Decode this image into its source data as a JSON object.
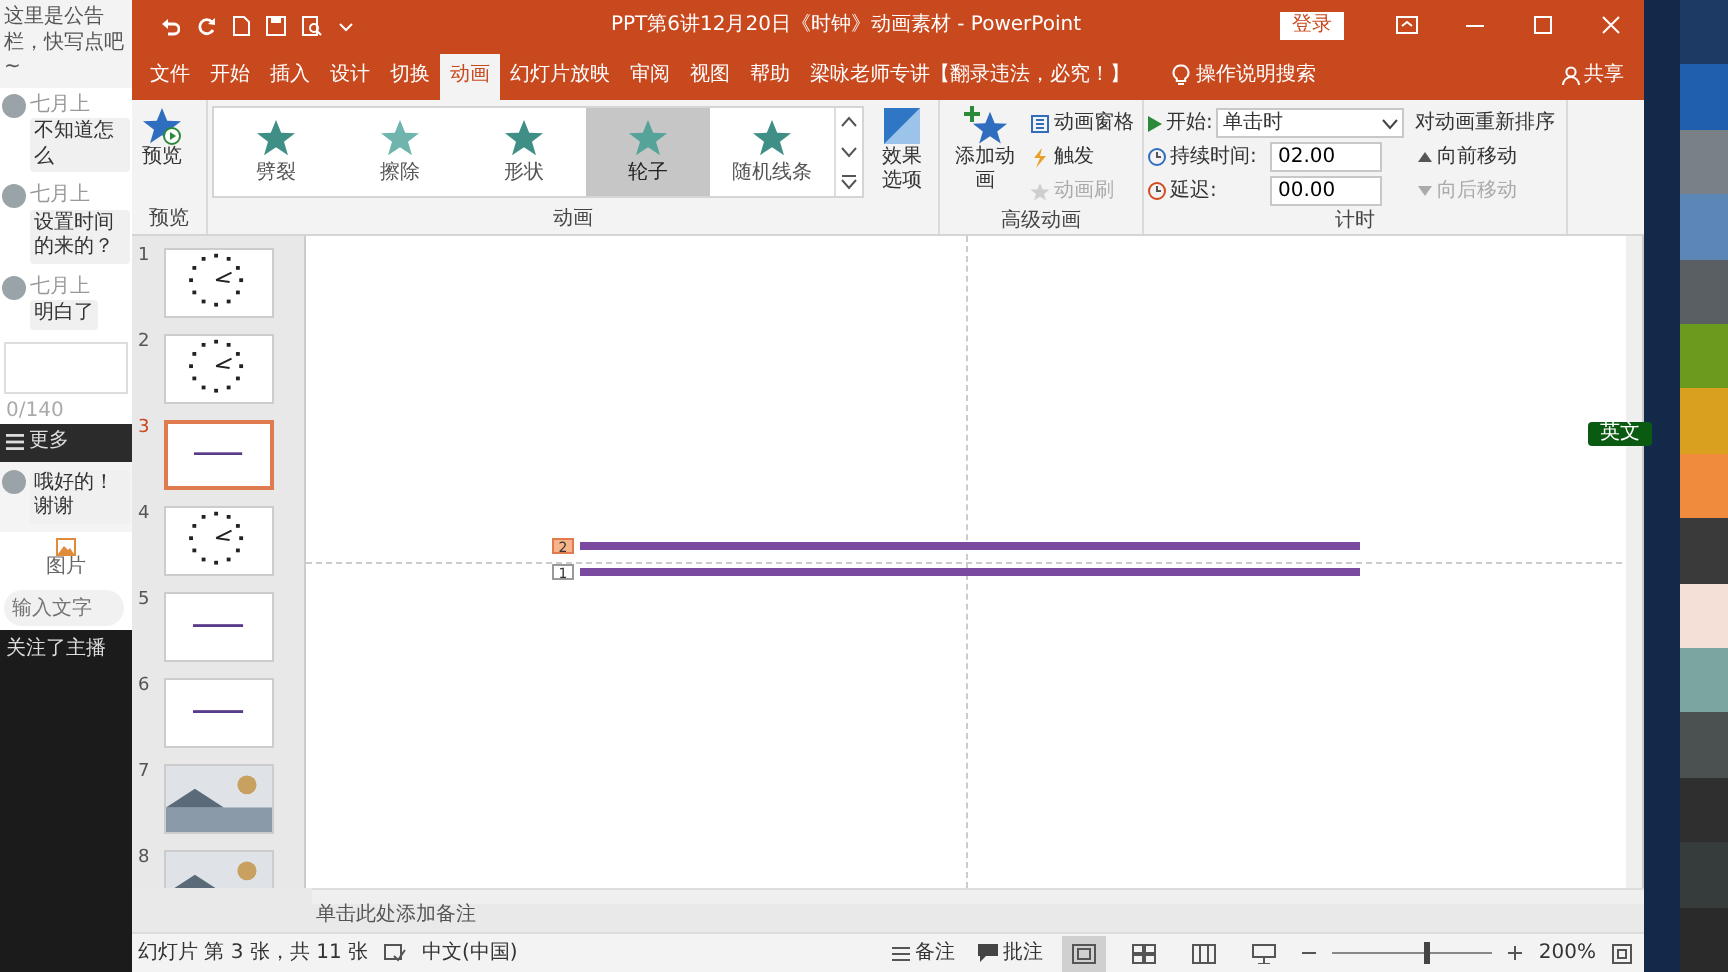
{
  "chat_panel": {
    "notice": "这里是公告栏，快写点吧~",
    "messages": [
      {
        "name": "七月上",
        "text": "不知道怎么"
      },
      {
        "name": "七月上",
        "text": "设置时间的来的？"
      },
      {
        "name": "七月上",
        "text": "明白了"
      }
    ],
    "counter": "0/140",
    "toolbar": [
      "更多"
    ],
    "reply": "哦好的！谢谢",
    "attachment": "图片",
    "input": {
      "placeholder": "输入文字"
    },
    "feed": [
      "关注了主播"
    ]
  },
  "window": {
    "title": "PPT第6讲12月20日《时钟》动画素材  -  PowerPoint",
    "login": "登录"
  },
  "tabs": [
    {
      "label": "文件",
      "selected": false
    },
    {
      "label": "开始",
      "selected": false
    },
    {
      "label": "插入",
      "selected": false
    },
    {
      "label": "设计",
      "selected": false
    },
    {
      "label": "切换",
      "selected": false
    },
    {
      "label": "动画",
      "selected": true
    },
    {
      "label": "幻灯片放映",
      "selected": false
    },
    {
      "label": "审阅",
      "selected": false
    },
    {
      "label": "视图",
      "selected": false
    },
    {
      "label": "帮助",
      "selected": false
    },
    {
      "label": "梁咏老师专讲【翻录违法，必究！】",
      "selected": false
    }
  ],
  "tell_me": "操作说明搜索",
  "share": "共享",
  "ribbon": {
    "preview": {
      "button": "预览",
      "group": "预览"
    },
    "animations": {
      "group": "动画",
      "effects": [
        {
          "label": "劈裂",
          "selected": false
        },
        {
          "label": "擦除",
          "selected": false
        },
        {
          "label": "形状",
          "selected": false
        },
        {
          "label": "轮子",
          "selected": true
        },
        {
          "label": "随机线条",
          "selected": false
        }
      ],
      "effect_options": "效果选项"
    },
    "advanced": {
      "group": "高级动画",
      "add": "添加动画",
      "items": [
        {
          "label": "动画窗格",
          "disabled": false
        },
        {
          "label": "触发",
          "disabled": false
        },
        {
          "label": "动画刷",
          "disabled": true
        }
      ]
    },
    "timing": {
      "group": "计时",
      "start_label": "开始:",
      "start_value": "单击时",
      "duration_label": "持续时间:",
      "duration_value": "02.00",
      "delay_label": "延迟:",
      "delay_value": "00.00",
      "reorder_title": "对动画重新排序",
      "reorder": [
        {
          "label": "向前移动",
          "disabled": false
        },
        {
          "label": "向后移动",
          "disabled": true
        }
      ]
    }
  },
  "slides": [
    {
      "number": "1",
      "kind": "clock",
      "selected": false
    },
    {
      "number": "2",
      "kind": "clock",
      "selected": false
    },
    {
      "number": "3",
      "kind": "line",
      "selected": true
    },
    {
      "number": "4",
      "kind": "clock",
      "selected": false
    },
    {
      "number": "5",
      "kind": "line",
      "selected": false
    },
    {
      "number": "6",
      "kind": "line",
      "selected": false
    },
    {
      "number": "7",
      "kind": "picture",
      "selected": false
    },
    {
      "number": "8",
      "kind": "picture",
      "selected": false
    }
  ],
  "canvas": {
    "animation_tags": [
      {
        "label": "2",
        "selected": true
      },
      {
        "label": "1",
        "selected": false
      }
    ],
    "ime_indicator": "英文"
  },
  "notes": {
    "placeholder": "单击此处添加备注"
  },
  "status_bar": {
    "slide_info": "幻灯片 第 3 张，共 11 张",
    "language": "中文(中国)",
    "notes": "备注",
    "comments": "批注",
    "zoom": {
      "level": 0.6,
      "reading": "200%"
    }
  },
  "palette": [
    {
      "color": "#1c3a63"
    },
    {
      "color": "#1f5fae"
    },
    {
      "color": "#7a8087"
    },
    {
      "color": "#5b86b5"
    },
    {
      "color": "#5a5f63"
    },
    {
      "color": "#6b9b1e"
    },
    {
      "color": "#d9a020"
    },
    {
      "color": "#f08a3c"
    },
    {
      "color": "#3a3a3a"
    },
    {
      "color": "#f5e0d8"
    },
    {
      "color": "#7aa5a0"
    },
    {
      "color": "#4b5050"
    },
    {
      "color": "#2f2f2f"
    },
    {
      "color": "#363b3b"
    },
    {
      "color": "#2a2a2a"
    }
  ]
}
